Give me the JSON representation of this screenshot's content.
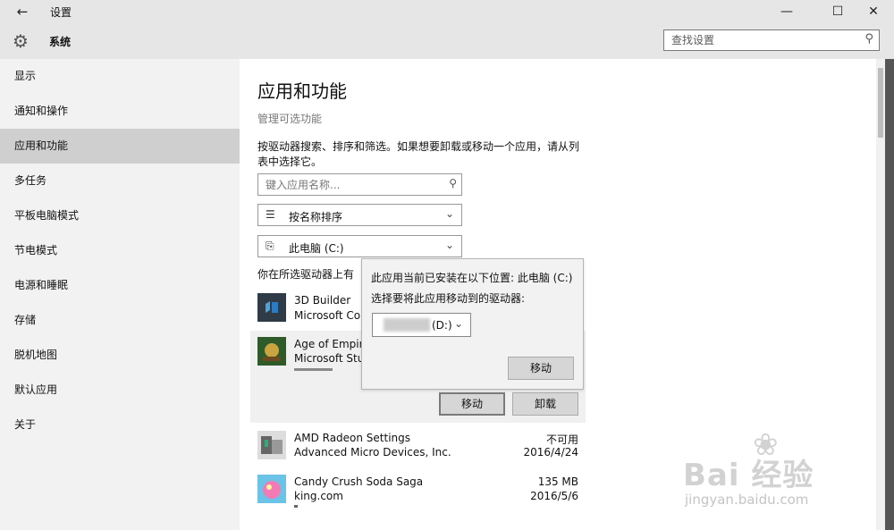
{
  "window": {
    "back_glyph": "←",
    "title": "设置",
    "minimize_glyph": "—",
    "maximize_glyph": "☐",
    "close_glyph": "✕"
  },
  "header": {
    "section": "系统",
    "search_placeholder": "查找设置"
  },
  "sidebar": {
    "items": [
      {
        "label": "显示"
      },
      {
        "label": "通知和操作"
      },
      {
        "label": "应用和功能",
        "active": true
      },
      {
        "label": "多任务"
      },
      {
        "label": "平板电脑模式"
      },
      {
        "label": "节电模式"
      },
      {
        "label": "电源和睡眠"
      },
      {
        "label": "存储"
      },
      {
        "label": "脱机地图"
      },
      {
        "label": "默认应用"
      },
      {
        "label": "关于"
      }
    ]
  },
  "main": {
    "title": "应用和功能",
    "manage_optional": "管理可选功能",
    "description": "按驱动器搜索、排序和筛选。如果想要卸载或移动一个应用，请从列表中选择它。",
    "search_placeholder": "键入应用名称...",
    "sort_label": "按名称排序",
    "drive_label": "此电脑 (C:)",
    "drive_note": "你在所选驱动器上有",
    "apps": [
      {
        "name": "3D Builder",
        "publisher": "Microsoft Co",
        "size": "",
        "date": ""
      },
      {
        "name": "Age of Empir",
        "publisher": "Microsoft Stu",
        "size": "",
        "date": ""
      },
      {
        "name": "AMD Radeon Settings",
        "publisher": "Advanced Micro Devices, Inc.",
        "size": "不可用",
        "date": "2016/4/24"
      },
      {
        "name": "Candy Crush Soda Saga",
        "publisher": "king.com",
        "size": "135 MB",
        "date": "2016/5/6"
      }
    ],
    "move_button": "移动",
    "uninstall_button": "卸载"
  },
  "popup": {
    "current_location": "此应用当前已安装在以下位置: 此电脑 (C:)",
    "choose_drive": "选择要将此应用移动到的驱动器:",
    "target_drive": "(D:)",
    "move_button": "移动"
  },
  "watermark": {
    "brand": "Bai  经验",
    "url": "jingyan.baidu.com"
  },
  "colors": {
    "sidebar_bg": "#f2f2f2",
    "active_item": "#cfcfcf",
    "header_bg": "#e6e6e6",
    "button_bg": "#d6d6d6"
  }
}
